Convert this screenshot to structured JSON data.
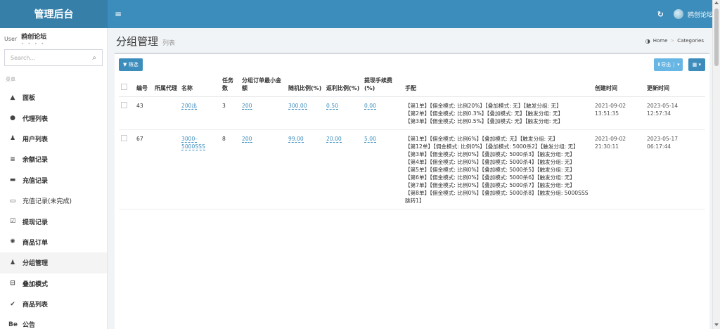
{
  "header": {
    "brand": "管理后台",
    "menu_toggle": "≡",
    "refresh_glyph": "↻",
    "username": "鸥创论坛"
  },
  "sidebar": {
    "user_img_alt": "User",
    "user_name": "鸥创论坛",
    "user_status": "• • • •",
    "search_placeholder": "Search...",
    "menu_header": "菜单",
    "items": [
      {
        "label": "面板",
        "icon": "area-chart-icon",
        "glyph": "▲"
      },
      {
        "label": "代理列表",
        "icon": "circle-icon",
        "glyph": "●"
      },
      {
        "label": "用户列表",
        "icon": "user-icon",
        "glyph": "♟"
      },
      {
        "label": "余额记录",
        "icon": "list-icon",
        "glyph": "≡"
      },
      {
        "label": "充值记录",
        "icon": "card-icon",
        "glyph": "▬"
      },
      {
        "label": "充值记录(未完成)",
        "icon": "tag-icon",
        "glyph": "▭"
      },
      {
        "label": "提现记录",
        "icon": "check-square-icon",
        "glyph": "☑"
      },
      {
        "label": "商品订单",
        "icon": "gear-icon",
        "glyph": "✺"
      },
      {
        "label": "分组管理",
        "icon": "users-icon",
        "glyph": "♟"
      },
      {
        "label": "叠加模式",
        "icon": "sitemap-icon",
        "glyph": "⊟"
      },
      {
        "label": "商品列表",
        "icon": "thumbs-icon",
        "glyph": "✔"
      },
      {
        "label": "公告",
        "icon": "behance-icon",
        "glyph": "Be"
      }
    ]
  },
  "page": {
    "title": "分组管理",
    "subtitle": "列表",
    "breadcrumb_home": "Home",
    "breadcrumb_sep": ">",
    "breadcrumb_current": "Categories"
  },
  "toolbar": {
    "filter_label": "▼ 筛选",
    "export_label": "⬇导出",
    "export_caret": "▾",
    "columns_label": "▦ ▾"
  },
  "table": {
    "headers": [
      "编号",
      "所属代理",
      "名称",
      "任务数",
      "分组订单最小金额",
      "随机比例(%)",
      "返利比例(%)",
      "提现手续费(%)",
      "手配",
      "创建时间",
      "更新时间"
    ],
    "rows": [
      {
        "id": "43",
        "agent": "",
        "name": "200出",
        "tasks": "3",
        "min_amount": "200",
        "random_ratio": "300.00",
        "rebate": "0.50",
        "fee": "0.00",
        "handles": [
          "【第1单】【佣金模式: 比例20%】【叠加模式: 无】【触发分组: 无】",
          "【第2单】【佣金模式: 比例0.3%】【叠加模式: 无】【触发分组: 无】",
          "【第3单】【佣金模式: 比例0.5%】【叠加模式: 无】【触发分组: 无】"
        ],
        "created": "2021-09-02 13:51:35",
        "updated": "2023-05-14 12:57:34"
      },
      {
        "id": "67",
        "agent": "",
        "name": "3000-5000SSS",
        "tasks": "8",
        "min_amount": "200",
        "random_ratio": "99.00",
        "rebate": "20.00",
        "fee": "5.00",
        "handles": [
          "【第1单】【佣金模式: 比例6%】【叠加模式: 无】【触发分组: 无】",
          "【第12单】【佣金模式: 比例0%】【叠加模式: 5000杀2】【触发分组: 无】",
          "【第3单】【佣金模式: 比例0%】【叠加模式: 5000杀3】【触发分组: 无】",
          "【第4单】【佣金模式: 比例0%】【叠加模式: 5000杀4】【触发分组: 无】",
          "【第5单】【佣金模式: 比例0%】【叠加模式: 5000杀5】【触发分组: 无】",
          "【第6单】【佣金模式: 比例0%】【叠加模式: 5000杀6】【触发分组: 无】",
          "【第7单】【佣金模式: 比例0%】【叠加模式: 5000杀7】【触发分组: 无】",
          "【第8单】【佣金模式: 比例0%】【叠加模式: 5000杀8】【触发分组: 5000SSS跳转1】"
        ],
        "created": "2021-09-02 21:30:11",
        "updated": "2023-05-17 06:17:44"
      }
    ]
  },
  "colors": {
    "brand_bg": "#367fa9",
    "navbar_bg": "#3c8dbc",
    "link": "#3c8dbc"
  }
}
